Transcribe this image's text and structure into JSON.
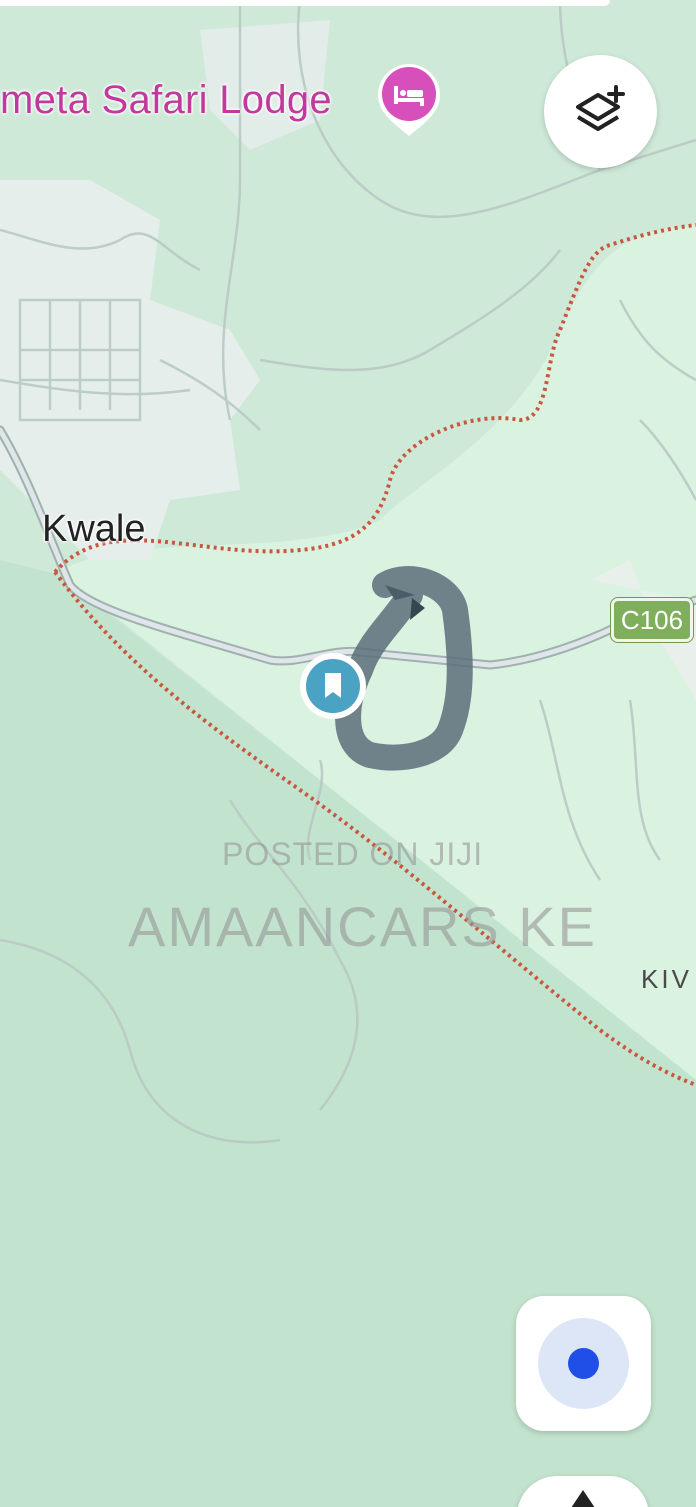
{
  "map": {
    "poi_label": "meta Safari Lodge",
    "poi_icon": "hotel-bed-icon",
    "poi_color": "#d64fbb",
    "town_label": "Kwale",
    "road_shield": "C106",
    "road_shield_color": "#7fae5c",
    "edge_label": "KIV",
    "saved_place_icon": "bookmark-pin-icon",
    "saved_place_color": "#4aa3c2",
    "boundary_color": "#c9563e"
  },
  "watermark": {
    "line1": "POSTED ON JIJI",
    "line2": "AMAANCARS KE"
  },
  "controls": {
    "layers_icon": "layers-plus-icon",
    "locate_icon": "my-location-icon",
    "locate_color": "#1f4fe6"
  }
}
